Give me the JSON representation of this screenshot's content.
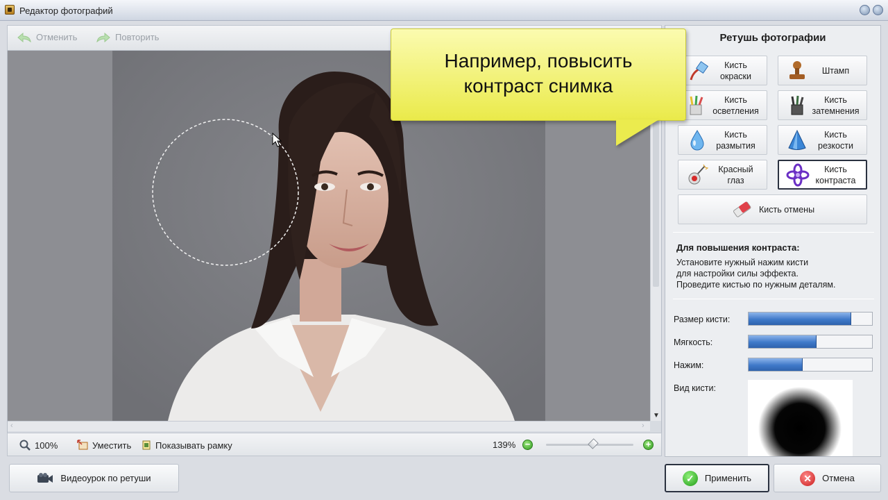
{
  "window": {
    "title": "Редактор фотографий"
  },
  "toolbar": {
    "undo_label": "Отменить",
    "redo_label": "Повторить"
  },
  "statusbar": {
    "zoom_100_label": "100%",
    "fit_label": "Уместить",
    "show_frame_label": "Показывать рамку",
    "zoom_level": "139%"
  },
  "callout": {
    "line1": "Например, повысить",
    "line2": "контраст снимка"
  },
  "panel": {
    "title": "Ретушь фотографии",
    "tools": [
      {
        "line1": "Кисть",
        "line2": "окраски",
        "icon": "paint-brush-icon"
      },
      {
        "line1": "Штамп",
        "line2": "",
        "icon": "stamp-icon"
      },
      {
        "line1": "Кисть",
        "line2": "осветления",
        "icon": "lighten-brush-icon"
      },
      {
        "line1": "Кисть",
        "line2": "затемнения",
        "icon": "darken-brush-icon"
      },
      {
        "line1": "Кисть",
        "line2": "размытия",
        "icon": "blur-drop-icon"
      },
      {
        "line1": "Кисть",
        "line2": "резкости",
        "icon": "sharpen-cone-icon"
      },
      {
        "line1": "Красный",
        "line2": "глаз",
        "icon": "red-eye-icon"
      },
      {
        "line1": "Кисть",
        "line2": "контраста",
        "icon": "contrast-brush-icon"
      },
      {
        "line1": "Кисть отмены",
        "line2": "",
        "icon": "eraser-icon"
      }
    ],
    "info": {
      "heading": "Для повышения контраста:",
      "line1": "Установите нужный нажим кисти",
      "line2": "для настройки силы эффекта.",
      "line3": "Проведите кистью по нужным деталям."
    },
    "params": {
      "size_label": "Размер кисти:",
      "size_value": 0.83,
      "softness_label": "Мягкость:",
      "softness_value": 0.55,
      "pressure_label": "Нажим:",
      "pressure_value": 0.44,
      "brush_view_label": "Вид кисти:"
    },
    "apply_label": "Применить",
    "cancel_label": "Отмена"
  },
  "video_button_label": "Видеоурок по ретуши"
}
